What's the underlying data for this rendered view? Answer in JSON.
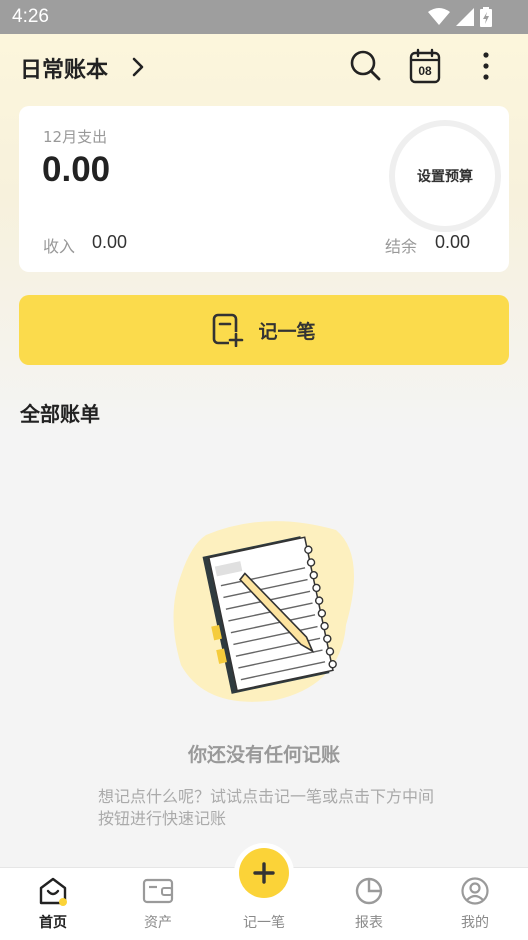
{
  "status_bar": {
    "time": "4:26"
  },
  "header": {
    "title": "日常账本"
  },
  "calendar_day": "08",
  "summary": {
    "month_label": "12月支出",
    "expense_amount": "0.00",
    "income_label": "收入",
    "income_value": "0.00",
    "balance_label": "结余",
    "balance_value": "0.00",
    "budget_button": "设置预算"
  },
  "record_button": {
    "label": "记一笔"
  },
  "section": {
    "title": "全部账单"
  },
  "empty_state": {
    "title": "你还没有任何记账",
    "hint": "想记点什么呢？试试点击记一笔或点击下方中间按钮进行快速记账"
  },
  "bottom_nav": [
    {
      "label": "首页",
      "icon": "home-icon",
      "active": true
    },
    {
      "label": "资产",
      "icon": "wallet-icon",
      "active": false
    },
    {
      "label": "记一笔",
      "icon": "plus-icon",
      "active": false
    },
    {
      "label": "报表",
      "icon": "pie-chart-icon",
      "active": false
    },
    {
      "label": "我的",
      "icon": "profile-icon",
      "active": false
    }
  ],
  "colors": {
    "accent": "#fbdb4c",
    "fab": "#fbd338",
    "background": "#f4f4f4"
  }
}
